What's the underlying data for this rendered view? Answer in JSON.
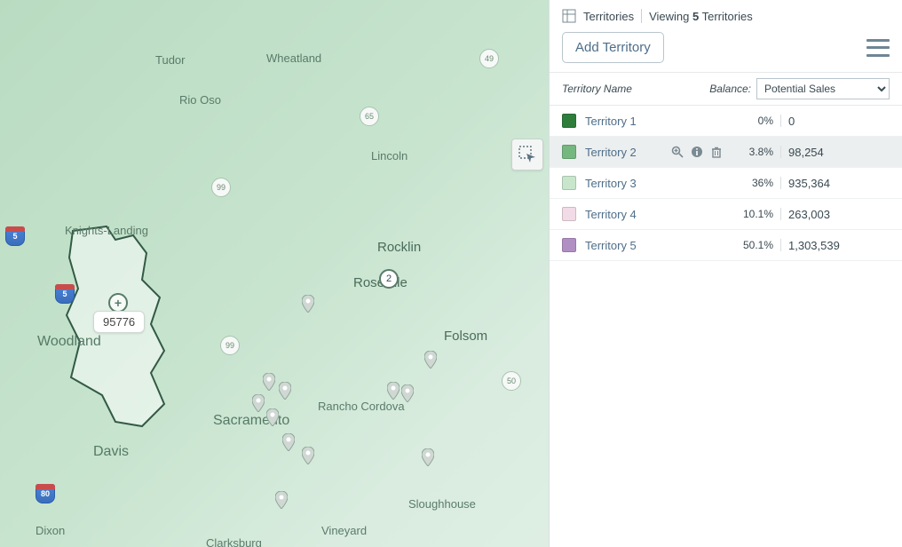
{
  "panel": {
    "title": "Territories",
    "viewing_prefix": "Viewing",
    "viewing_count": "5",
    "viewing_suffix": "Territories",
    "add_button": "Add Territory",
    "columns": {
      "name": "Territory Name",
      "balance_label": "Balance:",
      "balance_selected": "Potential Sales"
    }
  },
  "territories": [
    {
      "name": "Territory 1",
      "color": "#2f7d3b",
      "pct": "0%",
      "value": "0",
      "selected": false
    },
    {
      "name": "Territory 2",
      "color": "#74b77f",
      "pct": "3.8%",
      "value": "98,254",
      "selected": true
    },
    {
      "name": "Territory 3",
      "color": "#c7e6cc",
      "pct": "36%",
      "value": "935,364",
      "selected": false
    },
    {
      "name": "Territory 4",
      "color": "#f0dbe6",
      "pct": "10.1%",
      "value": "263,003",
      "selected": false
    },
    {
      "name": "Territory 5",
      "color": "#b08fc3",
      "pct": "50.1%",
      "value": "1,303,539",
      "selected": false
    }
  ],
  "map": {
    "zip_tooltip": "95776",
    "marker_label": "2",
    "labels": {
      "tudor": "Tudor",
      "wheatland": "Wheatland",
      "rio_oso": "Rio Oso",
      "lincoln": "Lincoln",
      "knightsLanding": "Knights-Landing",
      "rocklin": "Rocklin",
      "roseville": "Roseville",
      "folsom": "Folsom",
      "woodland": "Woodland",
      "davis": "Davis",
      "sacramento": "Sacramento",
      "rancho": "Rancho Cordova",
      "sloughhouse": "Sloughhouse",
      "vineyard": "Vineyard",
      "clarksburg": "Clarksburg",
      "dixon": "Dixon"
    },
    "routes": {
      "hwy65": "65",
      "hwy49": "49",
      "hwy99a": "99",
      "hwy99b": "99",
      "hwy50": "50",
      "i5a": "5",
      "i5b": "5",
      "i80": "80"
    }
  }
}
